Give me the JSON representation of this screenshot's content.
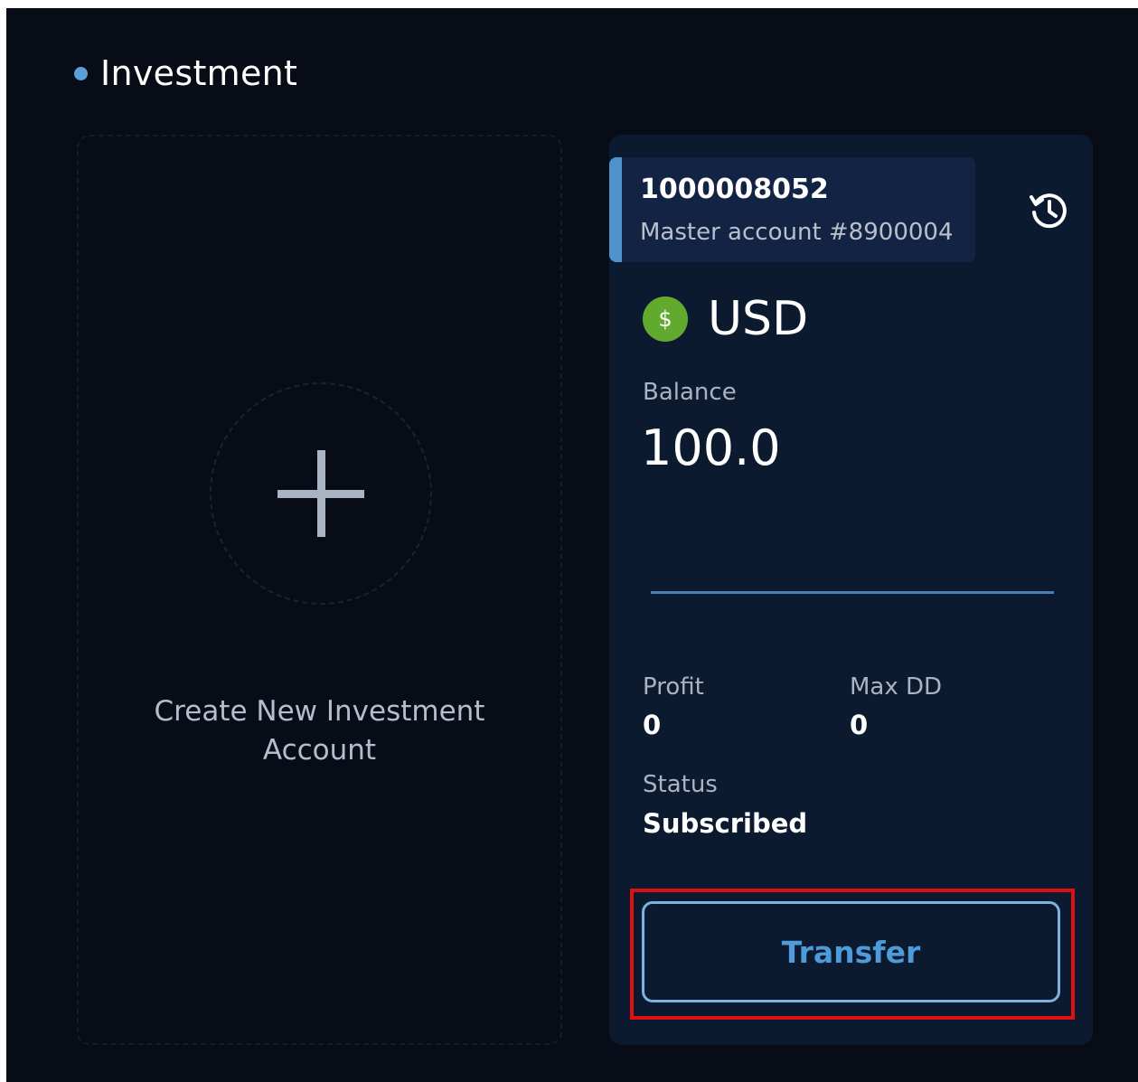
{
  "section": {
    "title": "Investment"
  },
  "create_card": {
    "label": "Create New Investment Account"
  },
  "account": {
    "number": "1000008052",
    "subtitle": "Master account #8900004",
    "currency_symbol": "$",
    "currency": "USD",
    "balance_label": "Balance",
    "balance": "100.0",
    "profit_label": "Profit",
    "profit": "0",
    "max_dd_label": "Max DD",
    "max_dd": "0",
    "status_label": "Status",
    "status": "Subscribed",
    "transfer_label": "Transfer"
  },
  "icons": {
    "history": "history-icon",
    "plus": "plus-icon",
    "currency": "dollar-coin-icon"
  },
  "colors": {
    "page_bg": "#080c16",
    "card_bg": "#0c1a30",
    "accent": "#4f92cc",
    "usd_green": "#62aa2e",
    "highlight": "#e01010"
  }
}
